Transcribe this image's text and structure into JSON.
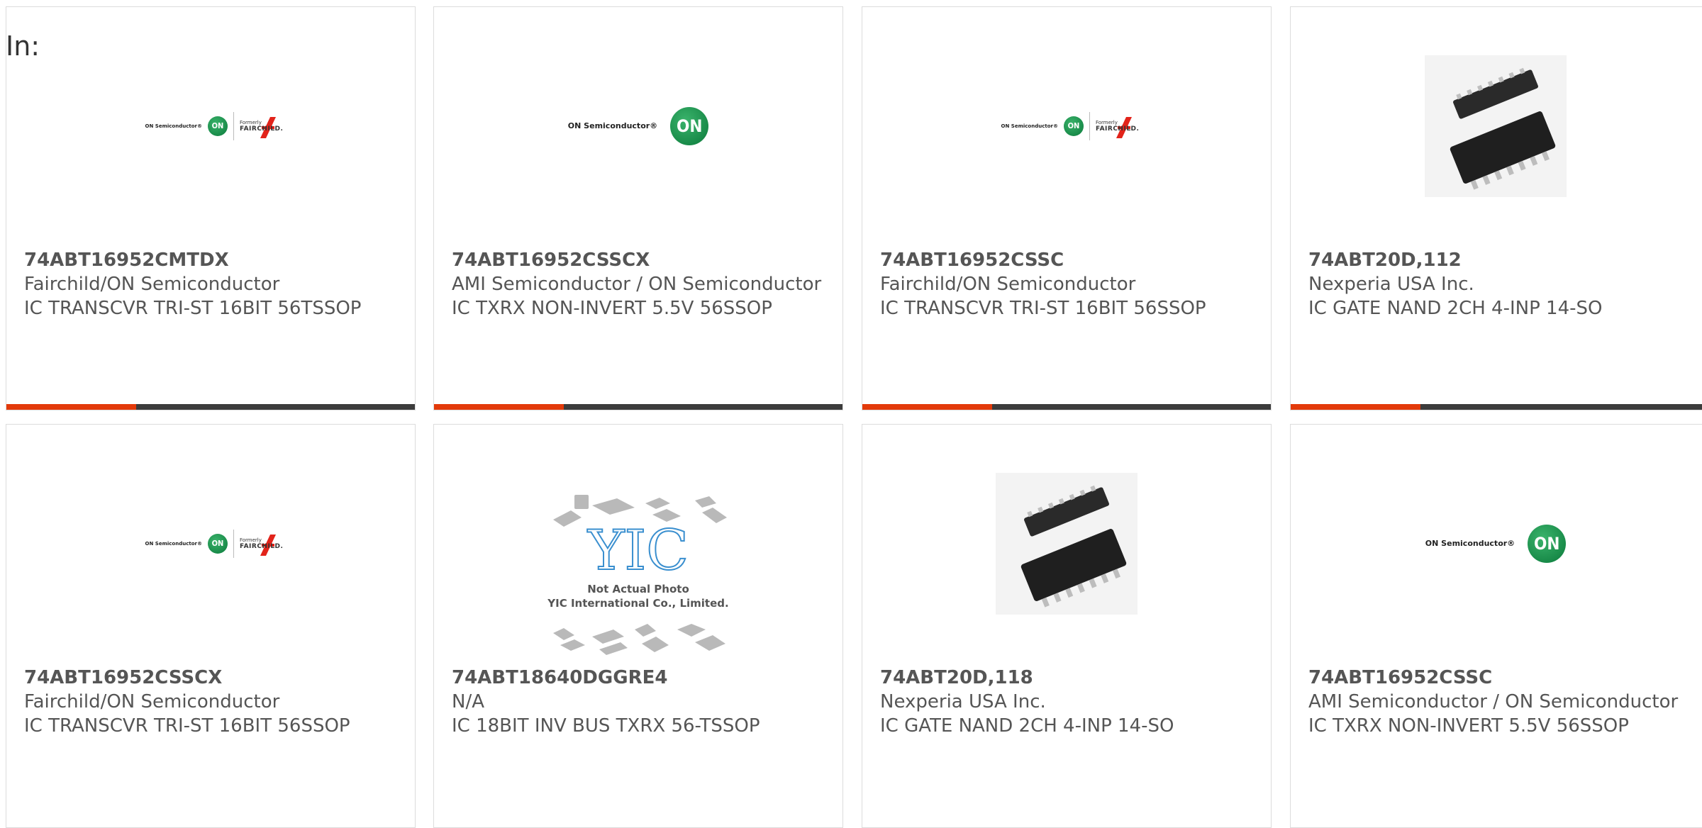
{
  "header": {
    "label": "In:"
  },
  "logos": {
    "on_text": "ON Semiconductor®",
    "on_mark": "ON",
    "formerly": "Formerly",
    "fairchild": "FAIRCHILD."
  },
  "placeholder_image": {
    "line1": "Not Actual Photo",
    "line2": "YIC International Co., Limited.",
    "mark": "YIC"
  },
  "products": [
    {
      "part": "74ABT16952CMTDX",
      "manufacturer": "Fairchild/ON Semiconductor",
      "description": "IC TRANSCVR TRI-ST 16BIT 56TSSOP",
      "image": "on-fairchild-logo"
    },
    {
      "part": "74ABT16952CSSCX",
      "manufacturer": "AMI Semiconductor / ON Semiconductor",
      "description": "IC TXRX NON-INVERT 5.5V 56SSOP",
      "image": "on-semiconductor-logo"
    },
    {
      "part": "74ABT16952CSSC",
      "manufacturer": "Fairchild/ON Semiconductor",
      "description": "IC TRANSCVR TRI-ST 16BIT 56SSOP",
      "image": "on-fairchild-logo"
    },
    {
      "part": "74ABT20D,112",
      "manufacturer": "Nexperia USA Inc.",
      "description": "IC GATE NAND 2CH 4-INP 14-SO",
      "image": "soic-chip-photo"
    },
    {
      "part": "74ABT16952CSSCX",
      "manufacturer": "Fairchild/ON Semiconductor",
      "description": "IC TRANSCVR TRI-ST 16BIT 56SSOP",
      "image": "on-fairchild-logo"
    },
    {
      "part": "74ABT18640DGGRE4",
      "manufacturer": "N/A",
      "description": "IC 18BIT INV BUS TXRX 56-TSSOP",
      "image": "yic-placeholder"
    },
    {
      "part": "74ABT20D,118",
      "manufacturer": "Nexperia USA Inc.",
      "description": "IC GATE NAND 2CH 4-INP 14-SO",
      "image": "soic-chip-photo"
    },
    {
      "part": "74ABT16952CSSC",
      "manufacturer": "AMI Semiconductor / ON Semiconductor",
      "description": "IC TXRX NON-INVERT 5.5V 56SSOP",
      "image": "on-semiconductor-logo"
    }
  ],
  "colors": {
    "accent": "#e33a0a",
    "bar": "#3c3c3c",
    "on_green": "#0b7a3b",
    "fairchild_red": "#e2231a"
  }
}
